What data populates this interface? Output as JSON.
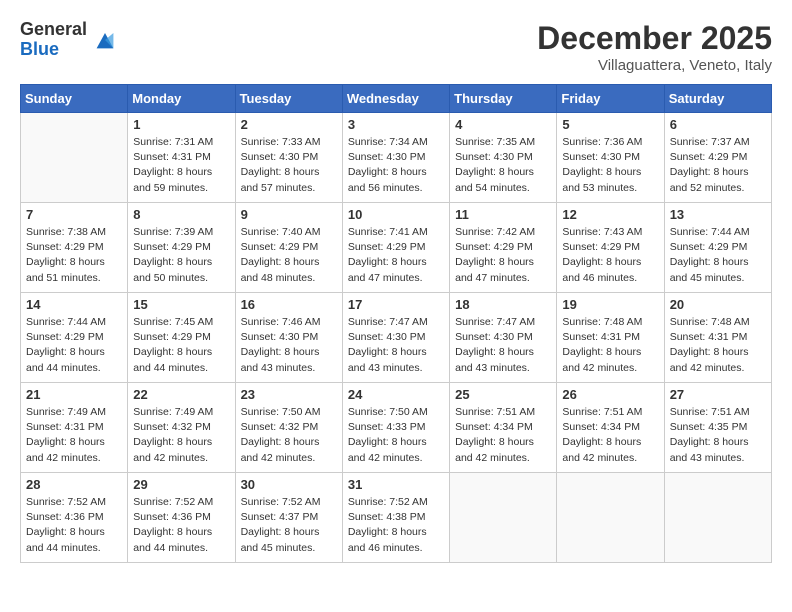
{
  "logo": {
    "general": "General",
    "blue": "Blue"
  },
  "title": "December 2025",
  "location": "Villaguattera, Veneto, Italy",
  "headers": [
    "Sunday",
    "Monday",
    "Tuesday",
    "Wednesday",
    "Thursday",
    "Friday",
    "Saturday"
  ],
  "weeks": [
    [
      {
        "day": "",
        "sunrise": "",
        "sunset": "",
        "daylight": ""
      },
      {
        "day": "1",
        "sunrise": "7:31 AM",
        "sunset": "4:31 PM",
        "daylight": "8 hours and 59 minutes."
      },
      {
        "day": "2",
        "sunrise": "7:33 AM",
        "sunset": "4:30 PM",
        "daylight": "8 hours and 57 minutes."
      },
      {
        "day": "3",
        "sunrise": "7:34 AM",
        "sunset": "4:30 PM",
        "daylight": "8 hours and 56 minutes."
      },
      {
        "day": "4",
        "sunrise": "7:35 AM",
        "sunset": "4:30 PM",
        "daylight": "8 hours and 54 minutes."
      },
      {
        "day": "5",
        "sunrise": "7:36 AM",
        "sunset": "4:30 PM",
        "daylight": "8 hours and 53 minutes."
      },
      {
        "day": "6",
        "sunrise": "7:37 AM",
        "sunset": "4:29 PM",
        "daylight": "8 hours and 52 minutes."
      }
    ],
    [
      {
        "day": "7",
        "sunrise": "7:38 AM",
        "sunset": "4:29 PM",
        "daylight": "8 hours and 51 minutes."
      },
      {
        "day": "8",
        "sunrise": "7:39 AM",
        "sunset": "4:29 PM",
        "daylight": "8 hours and 50 minutes."
      },
      {
        "day": "9",
        "sunrise": "7:40 AM",
        "sunset": "4:29 PM",
        "daylight": "8 hours and 48 minutes."
      },
      {
        "day": "10",
        "sunrise": "7:41 AM",
        "sunset": "4:29 PM",
        "daylight": "8 hours and 47 minutes."
      },
      {
        "day": "11",
        "sunrise": "7:42 AM",
        "sunset": "4:29 PM",
        "daylight": "8 hours and 47 minutes."
      },
      {
        "day": "12",
        "sunrise": "7:43 AM",
        "sunset": "4:29 PM",
        "daylight": "8 hours and 46 minutes."
      },
      {
        "day": "13",
        "sunrise": "7:44 AM",
        "sunset": "4:29 PM",
        "daylight": "8 hours and 45 minutes."
      }
    ],
    [
      {
        "day": "14",
        "sunrise": "7:44 AM",
        "sunset": "4:29 PM",
        "daylight": "8 hours and 44 minutes."
      },
      {
        "day": "15",
        "sunrise": "7:45 AM",
        "sunset": "4:29 PM",
        "daylight": "8 hours and 44 minutes."
      },
      {
        "day": "16",
        "sunrise": "7:46 AM",
        "sunset": "4:30 PM",
        "daylight": "8 hours and 43 minutes."
      },
      {
        "day": "17",
        "sunrise": "7:47 AM",
        "sunset": "4:30 PM",
        "daylight": "8 hours and 43 minutes."
      },
      {
        "day": "18",
        "sunrise": "7:47 AM",
        "sunset": "4:30 PM",
        "daylight": "8 hours and 43 minutes."
      },
      {
        "day": "19",
        "sunrise": "7:48 AM",
        "sunset": "4:31 PM",
        "daylight": "8 hours and 42 minutes."
      },
      {
        "day": "20",
        "sunrise": "7:48 AM",
        "sunset": "4:31 PM",
        "daylight": "8 hours and 42 minutes."
      }
    ],
    [
      {
        "day": "21",
        "sunrise": "7:49 AM",
        "sunset": "4:31 PM",
        "daylight": "8 hours and 42 minutes."
      },
      {
        "day": "22",
        "sunrise": "7:49 AM",
        "sunset": "4:32 PM",
        "daylight": "8 hours and 42 minutes."
      },
      {
        "day": "23",
        "sunrise": "7:50 AM",
        "sunset": "4:32 PM",
        "daylight": "8 hours and 42 minutes."
      },
      {
        "day": "24",
        "sunrise": "7:50 AM",
        "sunset": "4:33 PM",
        "daylight": "8 hours and 42 minutes."
      },
      {
        "day": "25",
        "sunrise": "7:51 AM",
        "sunset": "4:34 PM",
        "daylight": "8 hours and 42 minutes."
      },
      {
        "day": "26",
        "sunrise": "7:51 AM",
        "sunset": "4:34 PM",
        "daylight": "8 hours and 42 minutes."
      },
      {
        "day": "27",
        "sunrise": "7:51 AM",
        "sunset": "4:35 PM",
        "daylight": "8 hours and 43 minutes."
      }
    ],
    [
      {
        "day": "28",
        "sunrise": "7:52 AM",
        "sunset": "4:36 PM",
        "daylight": "8 hours and 44 minutes."
      },
      {
        "day": "29",
        "sunrise": "7:52 AM",
        "sunset": "4:36 PM",
        "daylight": "8 hours and 44 minutes."
      },
      {
        "day": "30",
        "sunrise": "7:52 AM",
        "sunset": "4:37 PM",
        "daylight": "8 hours and 45 minutes."
      },
      {
        "day": "31",
        "sunrise": "7:52 AM",
        "sunset": "4:38 PM",
        "daylight": "8 hours and 46 minutes."
      },
      {
        "day": "",
        "sunrise": "",
        "sunset": "",
        "daylight": ""
      },
      {
        "day": "",
        "sunrise": "",
        "sunset": "",
        "daylight": ""
      },
      {
        "day": "",
        "sunrise": "",
        "sunset": "",
        "daylight": ""
      }
    ]
  ]
}
